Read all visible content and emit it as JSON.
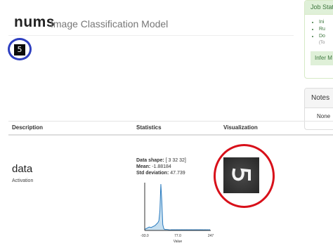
{
  "header": {
    "title": "nums",
    "subtitle": "Image Classification Model"
  },
  "input_image": {
    "digit": "5"
  },
  "job_panel": {
    "heading": "Job Stat",
    "items": [
      "Ini",
      "Ru",
      "Do"
    ],
    "note": "(To",
    "infer_button": "Infer M"
  },
  "notes_panel": {
    "heading": "Notes",
    "body": "None"
  },
  "table": {
    "headers": {
      "description": "Description",
      "statistics": "Statistics",
      "visualization": "Visualization"
    },
    "row": {
      "name": "data",
      "type": "Activation",
      "stats": {
        "shape_label": "Data shape:",
        "shape_value": "[ 3 32 32]",
        "mean_label": "Mean:",
        "mean_value": "-1.88184",
        "std_label": "Std deviation:",
        "std_value": "47.739"
      }
    }
  },
  "chart_data": {
    "type": "area",
    "x": [
      -93,
      -80,
      -70,
      -60,
      -50,
      -40,
      -30,
      -25,
      -20,
      -15,
      -10,
      -5,
      0,
      5,
      10,
      20,
      40,
      77,
      120,
      160,
      200,
      247
    ],
    "values": [
      0.02,
      0.05,
      0.07,
      0.06,
      0.08,
      0.1,
      0.14,
      0.16,
      0.2,
      0.4,
      0.95,
      0.6,
      0.12,
      0.04,
      0.02,
      0.02,
      0.01,
      0.01,
      0.01,
      0.01,
      0.01,
      0.0
    ],
    "tick_labels": [
      "-93.0",
      "77.0",
      "247"
    ],
    "xlim": [
      -93,
      247
    ],
    "xlabel": "Value",
    "fill_color": "#c6dff0",
    "line_color": "#2a7bbf"
  },
  "colors": {
    "annotation_blue": "#2e3fc0",
    "annotation_red": "#d8101a",
    "success_green": "#3c763d"
  }
}
